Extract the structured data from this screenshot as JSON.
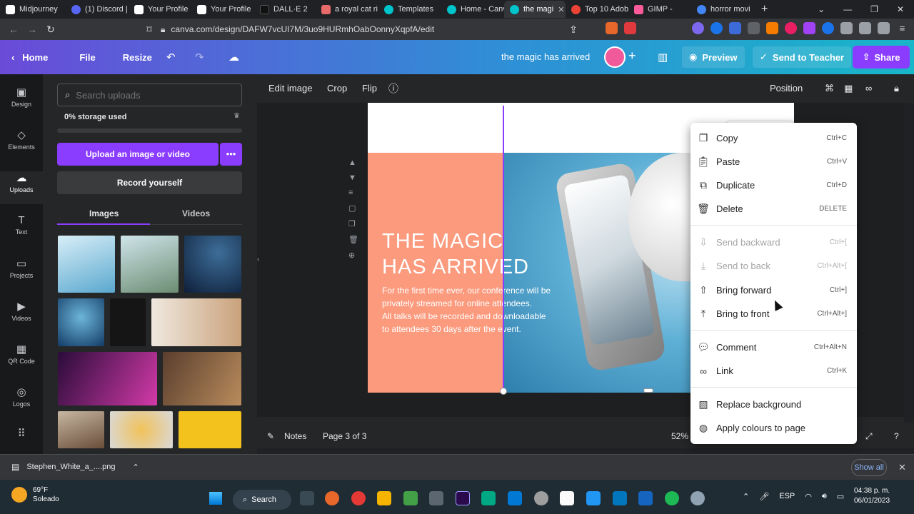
{
  "browser": {
    "tabs": [
      {
        "label": "Midjourney",
        "color": "#ffffff"
      },
      {
        "label": "(1) Discord |",
        "color": "#5865f2"
      },
      {
        "label": "Your Profile",
        "color": "#ffffff"
      },
      {
        "label": "Your Profile",
        "color": "#ffffff"
      },
      {
        "label": "DALL·E 2",
        "color": "#111111"
      },
      {
        "label": "a royal cat ri",
        "color": "#e86b6b"
      },
      {
        "label": "Templates",
        "color": "#00c4cc"
      },
      {
        "label": "Home - Canv",
        "color": "#00c4cc"
      },
      {
        "label": "the magi",
        "color": "#00c4cc"
      },
      {
        "label": "Top 10 Adob",
        "color": "#ea4335"
      },
      {
        "label": "GIMP - ",
        "color": "#ff5b9b"
      },
      {
        "label": "horror movi",
        "color": "#4285f4"
      }
    ],
    "url": "canva.com/design/DAFW7vcUI7M/3uo9HURmhOabOonnyXqpfA/edit"
  },
  "header": {
    "home": "Home",
    "file": "File",
    "resize": "Resize",
    "design_title": "the magic has arrived",
    "preview": "Preview",
    "send_to_teacher": "Send to Teacher",
    "share": "Share"
  },
  "rail": {
    "items": [
      "Design",
      "Elements",
      "Uploads",
      "Text",
      "Projects",
      "Videos",
      "QR Code",
      "Logos"
    ]
  },
  "panel": {
    "search_placeholder": "Search uploads",
    "storage": "0% storage used",
    "upload_button": "Upload an image or video",
    "record_button": "Record yourself",
    "tabs": [
      "Images",
      "Videos"
    ]
  },
  "toolbar": {
    "edit_image": "Edit image",
    "crop": "Crop",
    "flip": "Flip",
    "position": "Position"
  },
  "design": {
    "headline_line1": "THE MAGIC",
    "headline_line2": "HAS ARRIVED",
    "body_line1": "For the first time ever, our conference will be",
    "body_line2": "privately streamed for online attendees.",
    "body_line3": "All talks will be recorded and downloadable",
    "body_line4": "to attendees 30 days after the event."
  },
  "bottombar": {
    "notes": "Notes",
    "page": "Page 3 of 3",
    "zoom": "52%"
  },
  "context_menu": {
    "items": [
      {
        "label": "Copy",
        "shortcut": "Ctrl+C"
      },
      {
        "label": "Paste",
        "shortcut": "Ctrl+V"
      },
      {
        "label": "Duplicate",
        "shortcut": "Ctrl+D"
      },
      {
        "label": "Delete",
        "shortcut": "DELETE"
      },
      {
        "label": "Send backward",
        "shortcut": "Ctrl+["
      },
      {
        "label": "Send to back",
        "shortcut": "Ctrl+Alt+["
      },
      {
        "label": "Bring forward",
        "shortcut": "Ctrl+]"
      },
      {
        "label": "Bring to front",
        "shortcut": "Ctrl+Alt+]"
      },
      {
        "label": "Comment",
        "shortcut": "Ctrl+Alt+N"
      },
      {
        "label": "Link",
        "shortcut": "Ctrl+K"
      },
      {
        "label": "Replace background",
        "shortcut": ""
      },
      {
        "label": "Apply colours to page",
        "shortcut": ""
      }
    ]
  },
  "downloads": {
    "file": "Stephen_White_a_....png",
    "show_all": "Show all"
  },
  "taskbar": {
    "temp": "69°F",
    "weather": "Soleado",
    "search": "Search",
    "lang": "ESP",
    "time": "04:38 p. m.",
    "date": "06/01/2023"
  }
}
